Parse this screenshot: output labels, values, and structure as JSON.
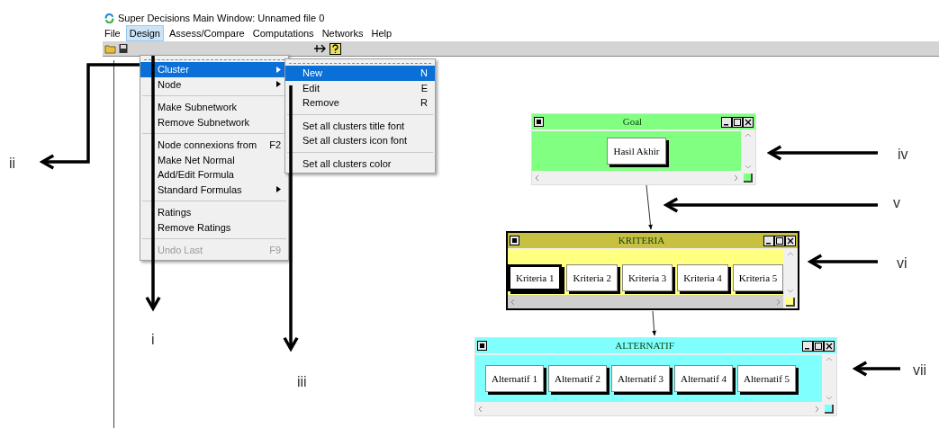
{
  "window": {
    "title": "Super Decisions Main Window: Unnamed file 0"
  },
  "menu_bar": [
    {
      "label": "File",
      "selected": false
    },
    {
      "label": "Design",
      "selected": true
    },
    {
      "label": "Assess/Compare",
      "selected": false
    },
    {
      "label": "Computations",
      "selected": false
    },
    {
      "label": "Networks",
      "selected": false
    },
    {
      "label": "Help",
      "selected": false
    }
  ],
  "design_menu": [
    [
      {
        "label": "Cluster",
        "has_submenu": true,
        "selected": true,
        "disabled": false
      },
      {
        "label": "Node",
        "has_submenu": true,
        "selected": false,
        "disabled": false
      }
    ],
    [
      {
        "label": "Make Subnetwork",
        "selected": false,
        "disabled": false
      },
      {
        "label": "Remove Subnetwork",
        "selected": false,
        "disabled": false
      }
    ],
    [
      {
        "label": "Node connexions from",
        "shortcut": "F2",
        "selected": false,
        "disabled": false
      },
      {
        "label": "Make Net Normal",
        "selected": false,
        "disabled": false
      },
      {
        "label": "Add/Edit Formula",
        "selected": false,
        "disabled": false
      },
      {
        "label": "Standard Formulas",
        "has_submenu": true,
        "selected": false,
        "disabled": false
      }
    ],
    [
      {
        "label": "Ratings",
        "selected": false,
        "disabled": false
      },
      {
        "label": "Remove Ratings",
        "selected": false,
        "disabled": false
      }
    ],
    [
      {
        "label": "Undo Last",
        "shortcut": "F9",
        "selected": false,
        "disabled": true
      }
    ]
  ],
  "cluster_submenu": [
    [
      {
        "label": "New",
        "shortcut": "N",
        "selected": true,
        "disabled": false
      },
      {
        "label": "Edit",
        "shortcut": "E",
        "selected": false,
        "disabled": false
      },
      {
        "label": "Remove",
        "shortcut": "R",
        "selected": false,
        "disabled": false
      }
    ],
    [
      {
        "label": "Set all clusters title font",
        "selected": false,
        "disabled": false
      },
      {
        "label": "Set all clusters icon font",
        "selected": false,
        "disabled": false
      }
    ],
    [
      {
        "label": "Set all clusters color",
        "selected": false,
        "disabled": false
      }
    ]
  ],
  "clusters": [
    {
      "title": "Goal",
      "color": "#80ff80",
      "nodes": [
        {
          "label": "Hasil Akhir",
          "selected": false
        }
      ]
    },
    {
      "title": "KRITERIA",
      "color": "#ffff80",
      "nodes": [
        {
          "label": "Kriteria 1",
          "selected": true
        },
        {
          "label": "Kriteria 2",
          "selected": false
        },
        {
          "label": "Kriteria 3",
          "selected": false
        },
        {
          "label": "Kriteria 4",
          "selected": false
        },
        {
          "label": "Kriteria 5",
          "selected": false
        }
      ]
    },
    {
      "title": "ALTERNATIF",
      "color": "#80ffff",
      "nodes": [
        {
          "label": "Alternatif 1",
          "selected": false
        },
        {
          "label": "Alternatif 2",
          "selected": false
        },
        {
          "label": "Alternatif 3",
          "selected": false
        },
        {
          "label": "Alternatif 4",
          "selected": false
        },
        {
          "label": "Alternatif 5",
          "selected": false
        }
      ]
    }
  ],
  "annotations": [
    {
      "label": "i"
    },
    {
      "label": "ii"
    },
    {
      "label": "iii"
    },
    {
      "label": "iv"
    },
    {
      "label": "v"
    },
    {
      "label": "vi"
    },
    {
      "label": "vii"
    }
  ]
}
